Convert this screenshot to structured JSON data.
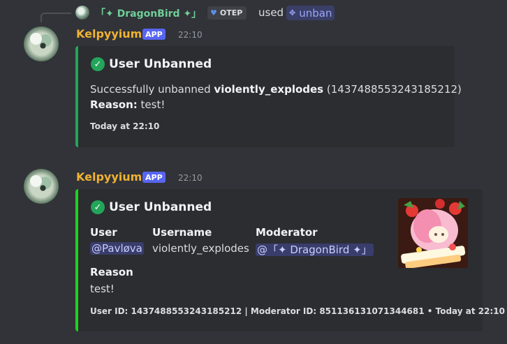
{
  "reply": {
    "user": "「✦ DragonBird ✦」",
    "tag_label": "OTEP",
    "used_text": "used",
    "command": "unban"
  },
  "messages": [
    {
      "username": "Kelpyyium",
      "badge": "APP",
      "time": "22:10",
      "embed": {
        "title": "User Unbanned",
        "line1_prefix": "Successfully unbanned ",
        "line1_user": "violently_explodes",
        "line1_id": " (1437488553243185212)",
        "reason_label": "Reason:",
        "reason_value": " test!",
        "footer": "Today at 22:10"
      }
    },
    {
      "username": "Kelpyyium",
      "badge": "APP",
      "time": "22:10",
      "embed": {
        "title": "User Unbanned",
        "fields": {
          "user_label": "User",
          "user_value": "@Pavløva",
          "username_label": "Username",
          "username_value": "violently_explodes",
          "moderator_label": "Moderator",
          "moderator_value": "@「✦ DragonBird ✦」",
          "reason_label": "Reason",
          "reason_value": "test!"
        },
        "footer": "User ID: 1437488553243185212 | Moderator ID: 851136131071344681 • Today at 22:10"
      }
    }
  ],
  "colors": {
    "background": "#313338",
    "embed_bg": "#2b2d31",
    "accent_first": "#23a55a",
    "accent_second": "#1fd11f",
    "username": "#f0b232",
    "app_badge": "#5865f2"
  }
}
